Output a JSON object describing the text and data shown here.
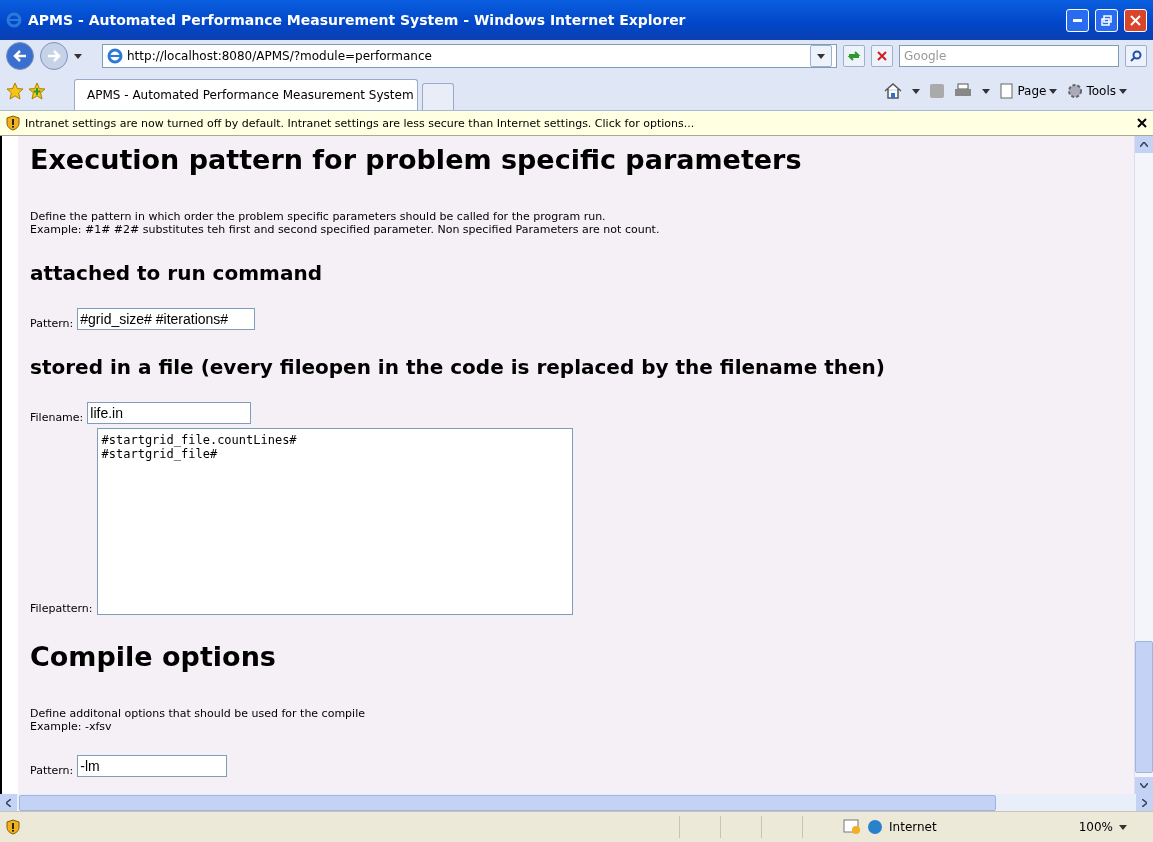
{
  "window": {
    "title": "APMS - Automated Performance Measurement System - Windows Internet Explorer"
  },
  "address_bar": {
    "url": "http://localhost:8080/APMS/?module=performance"
  },
  "search": {
    "placeholder": "Google"
  },
  "tabs": [
    {
      "label": "APMS - Automated Performance Measurement System",
      "selected": true
    }
  ],
  "command_bar": [
    "Page",
    "Tools"
  ],
  "info_bar": {
    "text": "Intranet settings are now turned off by default. Intranet settings are less secure than Internet settings. Click for options..."
  },
  "content": [
    {
      "kind": "heading1",
      "text": "Execution pattern for problem specific parameters"
    },
    {
      "kind": "paragraph",
      "lines": [
        "Define the pattern in which order the problem specific parameters should be called for the program run.",
        "Example: #1# #2# substitutes teh first and second specified parameter. Non specified Parameters are not count."
      ]
    },
    {
      "kind": "heading2",
      "text": "attached to run command"
    },
    {
      "kind": "field",
      "label": "Pattern:",
      "value": "#grid_size# #iterations#"
    },
    {
      "kind": "heading2",
      "text": "stored in a file (every fileopen in the code is replaced by the filename then)"
    },
    {
      "kind": "field",
      "label": "Filename:",
      "value": "life.in"
    },
    {
      "kind": "textarea",
      "label": "Filepattern:",
      "value": "#startgrid_file.countLines#\n#startgrid_file#"
    },
    {
      "kind": "heading1",
      "text": "Compile options"
    },
    {
      "kind": "paragraph",
      "lines": [
        "Define additonal options that should be used for the compile",
        "Example: -xfsv"
      ]
    },
    {
      "kind": "field",
      "label": "Pattern:",
      "value": "-lm"
    }
  ],
  "status_bar": {
    "zone": "Internet",
    "zoom": "100%"
  }
}
